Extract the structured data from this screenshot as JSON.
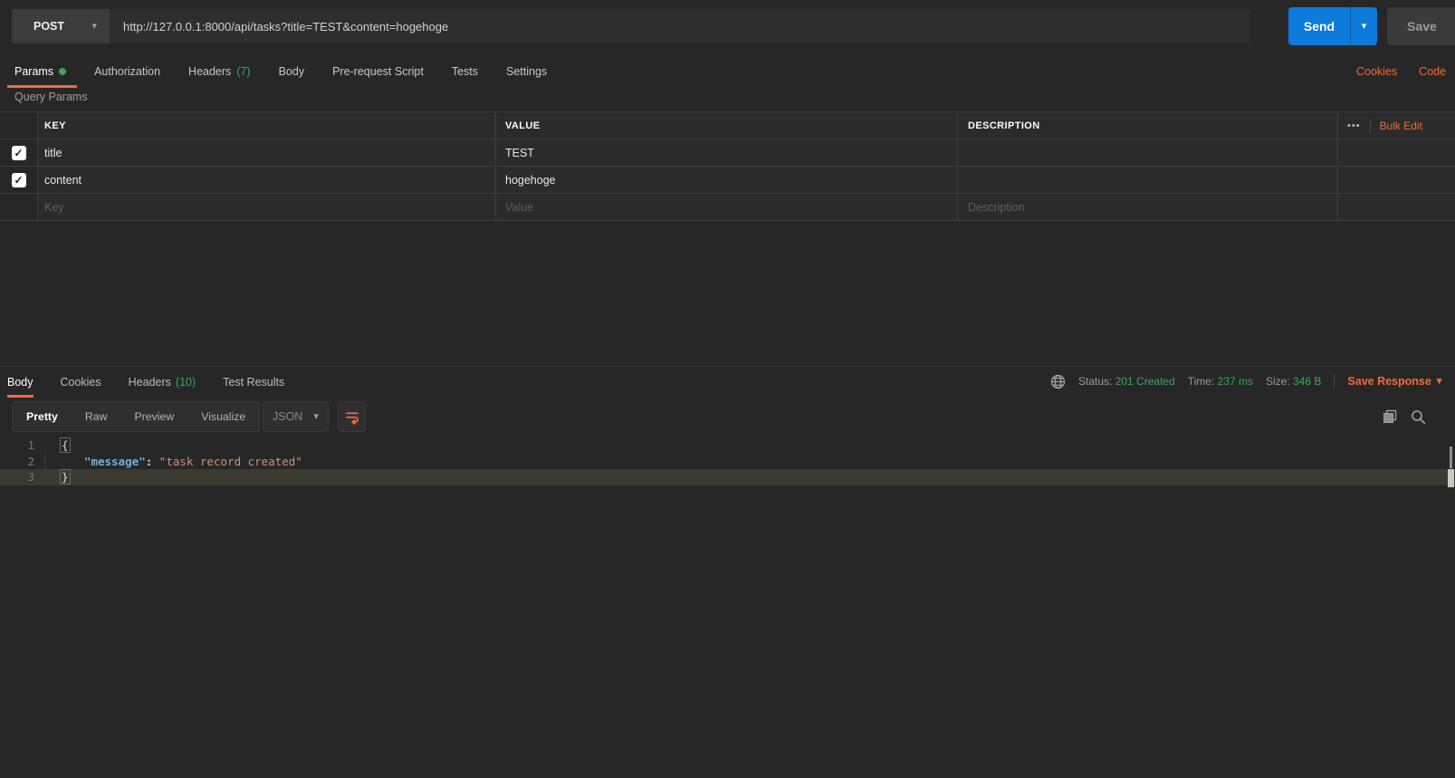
{
  "colors": {
    "accent_orange": "#f26b3a",
    "success_green": "#3fa65c",
    "primary_blue": "#0c7bdc",
    "json_key_blue": "#6fb3d9",
    "json_string_salmon": "#ce9178"
  },
  "icons": {
    "chevron_down": "▾",
    "more": "•••",
    "check": "✓"
  },
  "request": {
    "method": "POST",
    "url": "http://127.0.0.1:8000/api/tasks?title=TEST&content=hogehoge",
    "send_label": "Send",
    "save_label": "Save"
  },
  "request_tabs": {
    "items": [
      {
        "label": "Params",
        "active": true,
        "dot": true
      },
      {
        "label": "Authorization"
      },
      {
        "label": "Headers",
        "count": "(7)"
      },
      {
        "label": "Body"
      },
      {
        "label": "Pre-request Script"
      },
      {
        "label": "Tests"
      },
      {
        "label": "Settings"
      }
    ],
    "cookies_link": "Cookies",
    "code_link": "Code"
  },
  "params": {
    "section_title": "Query Params",
    "columns": [
      "KEY",
      "VALUE",
      "DESCRIPTION"
    ],
    "bulk_edit_label": "Bulk Edit",
    "rows": [
      {
        "checked": true,
        "key": "title",
        "value": "TEST",
        "description": ""
      },
      {
        "checked": true,
        "key": "content",
        "value": "hogehoge",
        "description": ""
      }
    ],
    "placeholder_row": {
      "key": "Key",
      "value": "Value",
      "description": "Description"
    }
  },
  "response": {
    "tabs": [
      {
        "label": "Body",
        "active": true
      },
      {
        "label": "Cookies"
      },
      {
        "label": "Headers",
        "count": "(10)"
      },
      {
        "label": "Test Results"
      }
    ],
    "meta": {
      "status_label": "Status:",
      "status_value": "201 Created",
      "time_label": "Time:",
      "time_value": "237 ms",
      "size_label": "Size:",
      "size_value": "346 B",
      "save_response_label": "Save Response"
    },
    "view_tabs": [
      {
        "label": "Pretty",
        "active": true
      },
      {
        "label": "Raw"
      },
      {
        "label": "Preview"
      },
      {
        "label": "Visualize"
      }
    ],
    "format_selector": "JSON",
    "code": {
      "lines": [
        {
          "num": "1",
          "segments": [
            {
              "cls": "brace",
              "text": "{"
            }
          ]
        },
        {
          "num": "2",
          "indent": true,
          "segments": [
            {
              "cls": "key",
              "text": "\"message\""
            },
            {
              "cls": "punct",
              "text": ": "
            },
            {
              "cls": "string",
              "text": "\"task record created\""
            }
          ]
        },
        {
          "num": "3",
          "highlight": true,
          "segments": [
            {
              "cls": "brace",
              "text": "}"
            }
          ]
        }
      ]
    }
  }
}
